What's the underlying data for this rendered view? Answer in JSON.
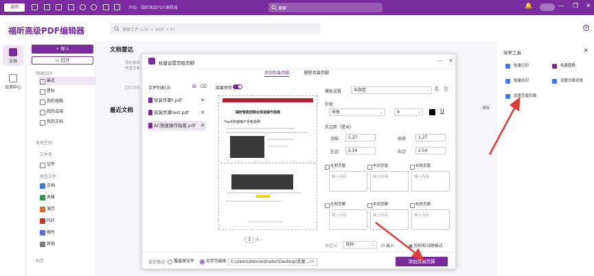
{
  "titlebar": {
    "home_label": "返回",
    "title": "开始 - 福昕高级PDF编辑器",
    "search_placeholder": "搜索",
    "window_controls": [
      "bell-icon",
      "avatar",
      "minimize-icon",
      "restore-icon",
      "close-icon"
    ]
  },
  "app": {
    "brand": "福昕高级PDF编辑器",
    "doc_search_placeholder": "搜索文件 (Ctrl + Shift + F)"
  },
  "rail": {
    "items": [
      {
        "label": "文档",
        "active": true
      },
      {
        "label": "应用中心",
        "active": false
      }
    ]
  },
  "sidebar": {
    "import_label": "+ 导入",
    "open_label": "打开",
    "quick_access_label": "快速访问",
    "quick_items": [
      "最近",
      "星标",
      "我的电脑",
      "我的云端",
      "我的文档"
    ],
    "local_label": "本地空间",
    "folders_label": "文件夹",
    "folder_items": [
      "证件"
    ],
    "category_label": "类型文件",
    "categories": [
      {
        "label": "文档",
        "color": "#3b7be8"
      },
      {
        "label": "表格",
        "color": "#2a9a4a"
      },
      {
        "label": "演示",
        "color": "#e26a2c"
      },
      {
        "label": "PDF",
        "color": "#c0392b"
      },
      {
        "label": "图片",
        "color": "#5b6ee1"
      },
      {
        "label": "其他",
        "color": "#7d7d7d"
      }
    ],
    "tags_label": "标签"
  },
  "main": {
    "radar_title": "文档雷达",
    "radar_text1": "我的桌面",
    "radar_text2": "快速查看",
    "recent_title": "最近文档",
    "pinned_text": "钉钉文件",
    "clear_label": "清除"
  },
  "right_panel": {
    "title": "效率工具",
    "tools": [
      "批量打印",
      "批量替换",
      "批量水印",
      "设置页面背景",
      "设置页眉页脚"
    ]
  },
  "dialog": {
    "title": "批量设置页眉页脚",
    "tab_add": "添加页眉页脚",
    "tab_remove": "删除页眉页脚",
    "files_header": "文件列表(3)",
    "files": [
      "安装步骤t.pdf",
      "安装步骤test.pdf",
      "AC快速操作指南.pdf"
    ],
    "selected_file_index": 2,
    "preview_label": "结果预览",
    "preview_doc_title": "福昕智能控制台快速操作指南",
    "preview_doc_title2": "Foxit快速用户手册说明",
    "page_current": "1",
    "page_total": "/6",
    "settings": {
      "template_label": "模板设置",
      "template_value": "未指定",
      "font_label": "外观",
      "font_value": "宋体",
      "size_value": "9",
      "margin_label": "页边距（厘米）",
      "top_label": "顶部",
      "top_value": "1.27",
      "bottom_label": "底部",
      "bottom_value": "1.27",
      "left_label": "左边",
      "left_value": "2.54",
      "right_label": "右边",
      "right_value": "2.54",
      "header_left": "左侧页眉",
      "header_mid": "中间页眉",
      "header_right": "右侧页眉",
      "footer_left": "左侧页脚",
      "footer_mid": "中间页脚",
      "footer_right": "右侧页脚",
      "input_placeholder": "输入内容",
      "custom_label": "自定义",
      "custom_value": "页码",
      "insert_label": "插入",
      "page_date_label": "页码和日期格式"
    },
    "save_path_label": "保存路径",
    "overwrite_label": "覆盖原文件",
    "save_copy_label": "另存为副本",
    "path_value": "C:\\Users\\Administrator\\Desktop\\批量...",
    "apply_label": "添加页眉页脚"
  },
  "colors": {
    "accent": "#7a2c9e",
    "arrow": "#e53935"
  }
}
